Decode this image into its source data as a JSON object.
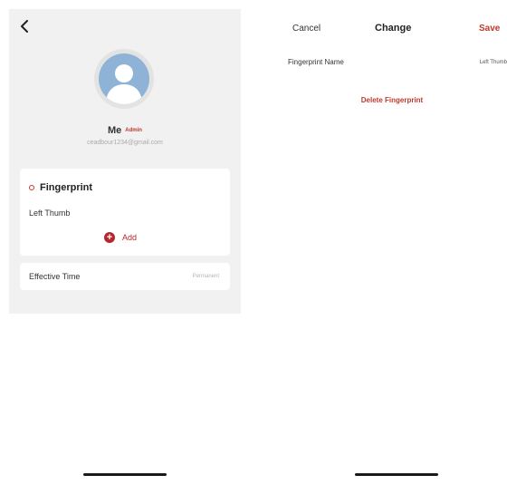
{
  "left_screen": {
    "user_name": "Me",
    "role_badge": "Admin",
    "email": "ceadbour1234@gmail.com",
    "fingerprint_section": {
      "title": "Fingerprint",
      "items": [
        "Left Thumb"
      ],
      "add_label": "Add"
    },
    "effective_time": {
      "label": "Effective Time",
      "value": "Permanent"
    }
  },
  "right_screen": {
    "nav": {
      "cancel_label": "Cancel",
      "title": "Change",
      "save_label": "Save"
    },
    "fingerprint_name": {
      "label": "Fingerprint Name",
      "value": "Left Thumb"
    },
    "delete_label": "Delete Fingerprint"
  },
  "colors": {
    "accent": "#b3282d",
    "background_gray": "#f1f1f1",
    "avatar_blue": "#8fb3d6"
  },
  "icons": {
    "back": "chevron-left-icon",
    "avatar": "user-avatar-icon",
    "fingerprint_marker": "circle-marker-icon",
    "add": "plus-circle-icon"
  }
}
